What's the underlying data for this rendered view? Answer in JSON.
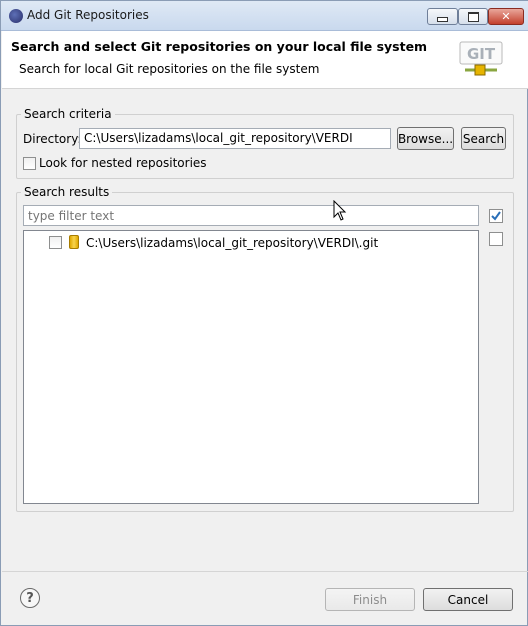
{
  "window": {
    "title": "Add Git Repositories"
  },
  "header": {
    "title": "Search and select Git repositories on your local file system",
    "subtitle": "Search for local Git repositories on the file system",
    "logo_text": "GIT"
  },
  "search_criteria": {
    "group_label": "Search criteria",
    "directory_label": "Directory:",
    "directory_value": "C:\\Users\\lizadams\\local_git_repository\\VERDI",
    "browse_label": "Browse...",
    "search_label": "Search",
    "nested_label": "Look for nested repositories",
    "nested_checked": false
  },
  "search_results": {
    "group_label": "Search results",
    "filter_placeholder": "type filter text",
    "select_all_checked": true,
    "deselect_all_checked": false,
    "items": [
      {
        "label": "C:\\Users\\lizadams\\local_git_repository\\VERDI\\.git",
        "checked": false
      }
    ]
  },
  "footer": {
    "help_symbol": "?",
    "finish_label": "Finish",
    "finish_enabled": false,
    "cancel_label": "Cancel"
  }
}
